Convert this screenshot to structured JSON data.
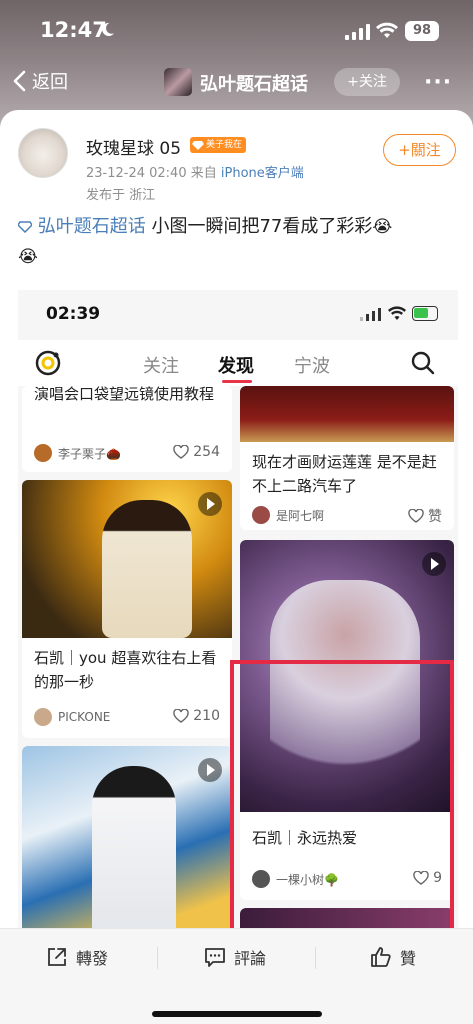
{
  "status": {
    "time": "12:47",
    "battery": "98"
  },
  "nav": {
    "back_label": "返回",
    "topic_title": "弘叶题石超话",
    "follow_label": "+关注",
    "more": "···"
  },
  "post": {
    "username": "玫瑰星球 05",
    "badge": "美子我在",
    "date": "23-12-24 02:40",
    "source_prefix": "来自",
    "source": "iPhone客户端",
    "location": "发布于 浙江",
    "follow_button": "+關注",
    "topic_link": "弘叶题石超话",
    "text": " 小图一瞬间把77看成了彩彩",
    "emoji": "😭"
  },
  "embed": {
    "time": "02:39",
    "tabs": [
      "关注",
      "发现",
      "宁波"
    ],
    "items": [
      {
        "title": "演唱会口袋望远镜使用教程",
        "author": "李子栗子🌰",
        "likes": "254"
      },
      {
        "title": "现在才画财运莲莲 是不是赶不上二路汽车了",
        "author": "是阿七啊",
        "likes": "赞"
      },
      {
        "title": "石凯｜you 超喜欢往右上看的那一秒",
        "author": "PICKONE",
        "likes": "210"
      },
      {
        "title": "石凯｜永远热爱",
        "author": "一棵小树🌳",
        "likes": "9"
      }
    ]
  },
  "actions": {
    "repost": "轉發",
    "comment": "評論",
    "like": "贊"
  },
  "colors": {
    "accent": "#f48a2a",
    "link": "#4b7fb8",
    "highlight": "#e52a45"
  }
}
